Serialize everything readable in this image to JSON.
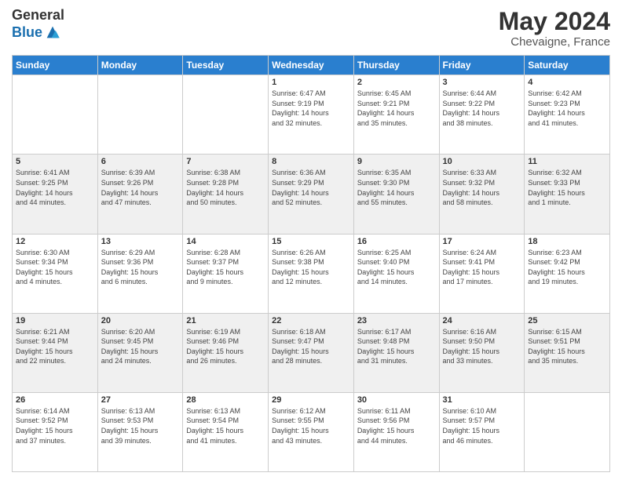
{
  "header": {
    "logo_general": "General",
    "logo_blue": "Blue",
    "title": "May 2024",
    "location": "Chevaigne, France"
  },
  "calendar": {
    "headers": [
      "Sunday",
      "Monday",
      "Tuesday",
      "Wednesday",
      "Thursday",
      "Friday",
      "Saturday"
    ],
    "rows": [
      [
        {
          "day": "",
          "info": ""
        },
        {
          "day": "",
          "info": ""
        },
        {
          "day": "",
          "info": ""
        },
        {
          "day": "1",
          "info": "Sunrise: 6:47 AM\nSunset: 9:19 PM\nDaylight: 14 hours\nand 32 minutes."
        },
        {
          "day": "2",
          "info": "Sunrise: 6:45 AM\nSunset: 9:21 PM\nDaylight: 14 hours\nand 35 minutes."
        },
        {
          "day": "3",
          "info": "Sunrise: 6:44 AM\nSunset: 9:22 PM\nDaylight: 14 hours\nand 38 minutes."
        },
        {
          "day": "4",
          "info": "Sunrise: 6:42 AM\nSunset: 9:23 PM\nDaylight: 14 hours\nand 41 minutes."
        }
      ],
      [
        {
          "day": "5",
          "info": "Sunrise: 6:41 AM\nSunset: 9:25 PM\nDaylight: 14 hours\nand 44 minutes."
        },
        {
          "day": "6",
          "info": "Sunrise: 6:39 AM\nSunset: 9:26 PM\nDaylight: 14 hours\nand 47 minutes."
        },
        {
          "day": "7",
          "info": "Sunrise: 6:38 AM\nSunset: 9:28 PM\nDaylight: 14 hours\nand 50 minutes."
        },
        {
          "day": "8",
          "info": "Sunrise: 6:36 AM\nSunset: 9:29 PM\nDaylight: 14 hours\nand 52 minutes."
        },
        {
          "day": "9",
          "info": "Sunrise: 6:35 AM\nSunset: 9:30 PM\nDaylight: 14 hours\nand 55 minutes."
        },
        {
          "day": "10",
          "info": "Sunrise: 6:33 AM\nSunset: 9:32 PM\nDaylight: 14 hours\nand 58 minutes."
        },
        {
          "day": "11",
          "info": "Sunrise: 6:32 AM\nSunset: 9:33 PM\nDaylight: 15 hours\nand 1 minute."
        }
      ],
      [
        {
          "day": "12",
          "info": "Sunrise: 6:30 AM\nSunset: 9:34 PM\nDaylight: 15 hours\nand 4 minutes."
        },
        {
          "day": "13",
          "info": "Sunrise: 6:29 AM\nSunset: 9:36 PM\nDaylight: 15 hours\nand 6 minutes."
        },
        {
          "day": "14",
          "info": "Sunrise: 6:28 AM\nSunset: 9:37 PM\nDaylight: 15 hours\nand 9 minutes."
        },
        {
          "day": "15",
          "info": "Sunrise: 6:26 AM\nSunset: 9:38 PM\nDaylight: 15 hours\nand 12 minutes."
        },
        {
          "day": "16",
          "info": "Sunrise: 6:25 AM\nSunset: 9:40 PM\nDaylight: 15 hours\nand 14 minutes."
        },
        {
          "day": "17",
          "info": "Sunrise: 6:24 AM\nSunset: 9:41 PM\nDaylight: 15 hours\nand 17 minutes."
        },
        {
          "day": "18",
          "info": "Sunrise: 6:23 AM\nSunset: 9:42 PM\nDaylight: 15 hours\nand 19 minutes."
        }
      ],
      [
        {
          "day": "19",
          "info": "Sunrise: 6:21 AM\nSunset: 9:44 PM\nDaylight: 15 hours\nand 22 minutes."
        },
        {
          "day": "20",
          "info": "Sunrise: 6:20 AM\nSunset: 9:45 PM\nDaylight: 15 hours\nand 24 minutes."
        },
        {
          "day": "21",
          "info": "Sunrise: 6:19 AM\nSunset: 9:46 PM\nDaylight: 15 hours\nand 26 minutes."
        },
        {
          "day": "22",
          "info": "Sunrise: 6:18 AM\nSunset: 9:47 PM\nDaylight: 15 hours\nand 28 minutes."
        },
        {
          "day": "23",
          "info": "Sunrise: 6:17 AM\nSunset: 9:48 PM\nDaylight: 15 hours\nand 31 minutes."
        },
        {
          "day": "24",
          "info": "Sunrise: 6:16 AM\nSunset: 9:50 PM\nDaylight: 15 hours\nand 33 minutes."
        },
        {
          "day": "25",
          "info": "Sunrise: 6:15 AM\nSunset: 9:51 PM\nDaylight: 15 hours\nand 35 minutes."
        }
      ],
      [
        {
          "day": "26",
          "info": "Sunrise: 6:14 AM\nSunset: 9:52 PM\nDaylight: 15 hours\nand 37 minutes."
        },
        {
          "day": "27",
          "info": "Sunrise: 6:13 AM\nSunset: 9:53 PM\nDaylight: 15 hours\nand 39 minutes."
        },
        {
          "day": "28",
          "info": "Sunrise: 6:13 AM\nSunset: 9:54 PM\nDaylight: 15 hours\nand 41 minutes."
        },
        {
          "day": "29",
          "info": "Sunrise: 6:12 AM\nSunset: 9:55 PM\nDaylight: 15 hours\nand 43 minutes."
        },
        {
          "day": "30",
          "info": "Sunrise: 6:11 AM\nSunset: 9:56 PM\nDaylight: 15 hours\nand 44 minutes."
        },
        {
          "day": "31",
          "info": "Sunrise: 6:10 AM\nSunset: 9:57 PM\nDaylight: 15 hours\nand 46 minutes."
        },
        {
          "day": "",
          "info": ""
        }
      ]
    ]
  }
}
